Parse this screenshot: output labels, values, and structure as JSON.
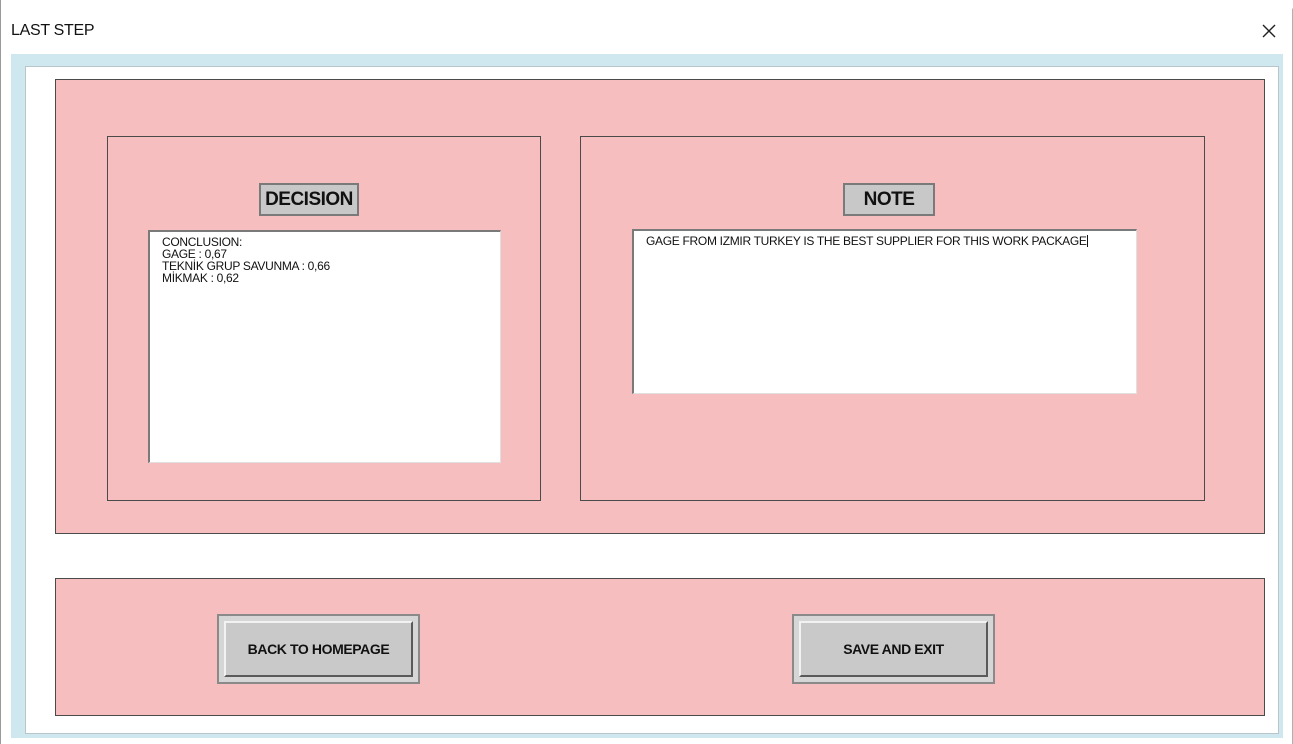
{
  "window": {
    "title": "LAST STEP",
    "close_icon": "close-icon"
  },
  "decision": {
    "label": "DECISION",
    "text": "CONCLUSION:\nGAGE : 0,67\nTEKNİK GRUP SAVUNMA : 0,66\nMİKMAK : 0,62"
  },
  "note": {
    "label": "NOTE",
    "text": "GAGE FROM IZMIR TURKEY IS THE BEST SUPPLIER FOR THIS WORK PACKAGE"
  },
  "buttons": {
    "back_label": "BACK TO HOMEPAGE",
    "save_label": "SAVE AND EXIT"
  },
  "colors": {
    "panel_pink": "#f7bec0",
    "client_blue": "#cfe7ef",
    "button_gray": "#c9c9c9"
  }
}
